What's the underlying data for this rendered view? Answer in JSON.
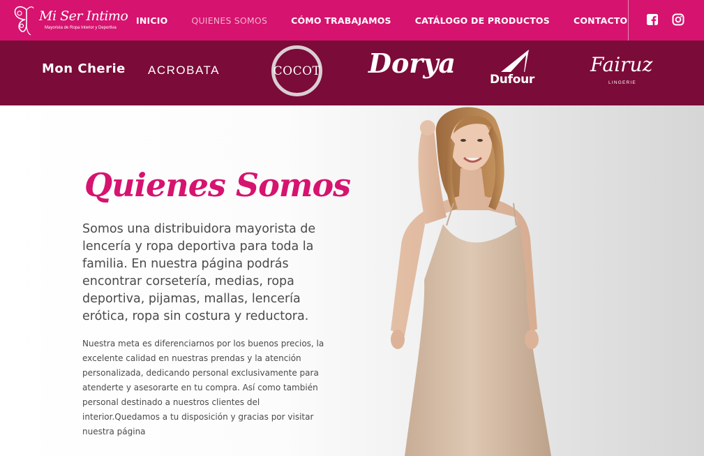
{
  "header": {
    "logo_text": "Mi Ser Intimo",
    "logo_tagline": "Mayorista de Ropa Interior y Deportiva",
    "nav": [
      {
        "label": "INICIO",
        "active": false
      },
      {
        "label": "QUIENES SOMOS",
        "active": true
      },
      {
        "label": "CÓMO TRABAJAMOS",
        "active": false
      },
      {
        "label": "CATÁLOGO DE PRODUCTOS",
        "active": false
      },
      {
        "label": "CONTACTO",
        "active": false
      }
    ],
    "social": [
      {
        "icon": "facebook-icon"
      },
      {
        "icon": "instagram-icon"
      }
    ]
  },
  "brands": {
    "items": [
      {
        "name": "Mon Cherie"
      },
      {
        "name": "ACROBATA"
      },
      {
        "name": "COCOT"
      },
      {
        "name": "Dorya"
      },
      {
        "name": "Dufour"
      },
      {
        "name": "Fairuz",
        "sub": "LINGERIE"
      }
    ]
  },
  "hero": {
    "title": "Quienes Somos",
    "lead": "Somos una distribuidora mayorista de lencería y ropa deportiva para toda la familia. En nuestra página podrás encontrar corsetería, medias, ropa deportiva, pijamas, mallas, lencería erótica, ropa sin costura y reductora.",
    "body": "Nuestra meta es diferenciarnos por los buenos precios, la excelente calidad en nuestras prendas y la atención personalizada, dedicando personal exclusivamente para atenderte y asesorarte en tu compra. Así como también personal destinado a nuestros clientes del interior.Quedamos a tu disposición y gracias por visitar nuestra página"
  },
  "colors": {
    "brand_pink": "#d6136f",
    "brand_bar": "#7b0b38",
    "text": "#4a4a4a"
  }
}
